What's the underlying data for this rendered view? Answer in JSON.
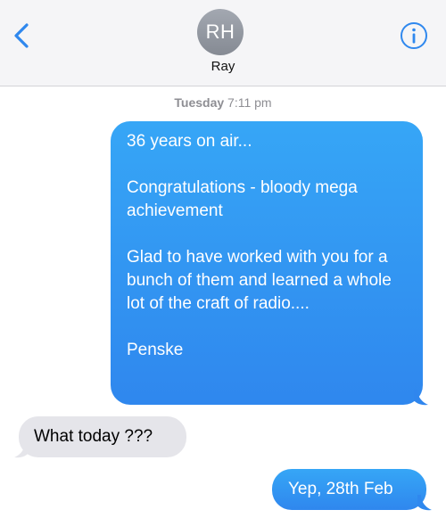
{
  "header": {
    "avatar_initials": "RH",
    "contact_name": "Ray",
    "back_icon": "chevron-left-icon",
    "info_icon": "info-icon"
  },
  "thread": {
    "timestamp_day": "Tuesday",
    "timestamp_time": "7:11 pm",
    "messages": [
      {
        "direction": "outgoing",
        "paragraphs": [
          "36 years on air...",
          "Congratulations - bloody mega achievement",
          "Glad to have worked with you for a bunch of them and learned a whole lot of the craft of radio....",
          "Penske"
        ]
      },
      {
        "direction": "incoming",
        "text": "What today ???"
      },
      {
        "direction": "outgoing",
        "text": "Yep, 28th Feb"
      }
    ]
  },
  "colors": {
    "accent": "#2f88ee",
    "incoming_bubble": "#e5e5ea",
    "header_bg": "#f5f5f7",
    "timestamp": "#8e8e93"
  }
}
